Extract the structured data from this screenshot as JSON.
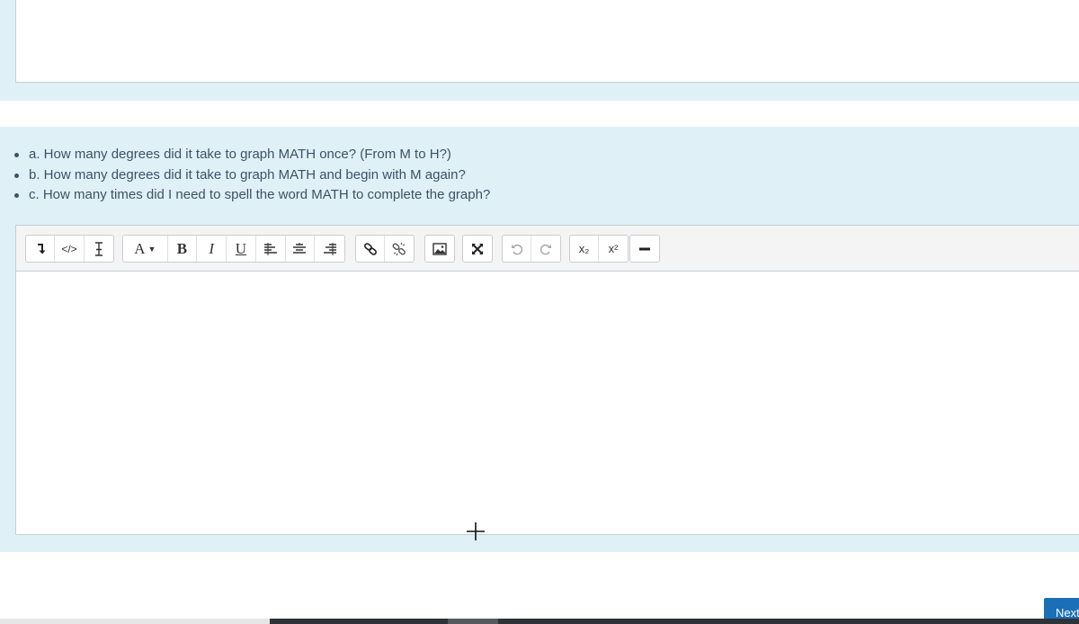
{
  "questions": [
    "a. How many degrees did it take to graph MATH once? (From M to H?)",
    "b. How many degrees did it take to graph MATH and begin with M again?",
    "c. How many times did I need to spell the word MATH to complete the graph?"
  ],
  "toolbar": {
    "font_color_label": "A",
    "bold_label": "B",
    "italic_label": "I",
    "underline_label": "U",
    "subscript_label": "x₂",
    "superscript_label": "x²"
  },
  "navigation": {
    "next_label": "Next"
  },
  "colors": {
    "band": "#dff0f7",
    "next_button": "#1a6fb7",
    "border": "#c8cdd1"
  }
}
